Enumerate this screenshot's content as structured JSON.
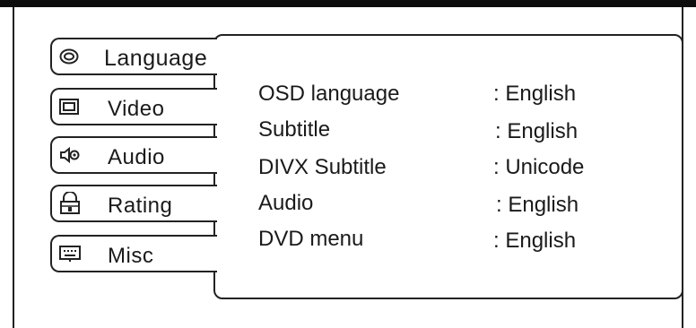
{
  "tabs": [
    {
      "label": "Language",
      "icon": "disc-icon"
    },
    {
      "label": "Video",
      "icon": "monitor-icon"
    },
    {
      "label": "Audio",
      "icon": "speaker-icon"
    },
    {
      "label": "Rating",
      "icon": "lock-icon"
    },
    {
      "label": "Misc",
      "icon": "keyboard-icon"
    }
  ],
  "settings": [
    {
      "label": "OSD language",
      "value": ": English"
    },
    {
      "label": "Subtitle",
      "value": ": English"
    },
    {
      "label": "DIVX Subtitle",
      "value": ": Unicode"
    },
    {
      "label": "Audio",
      "value": ": English"
    },
    {
      "label": "DVD menu",
      "value": ": English"
    }
  ]
}
